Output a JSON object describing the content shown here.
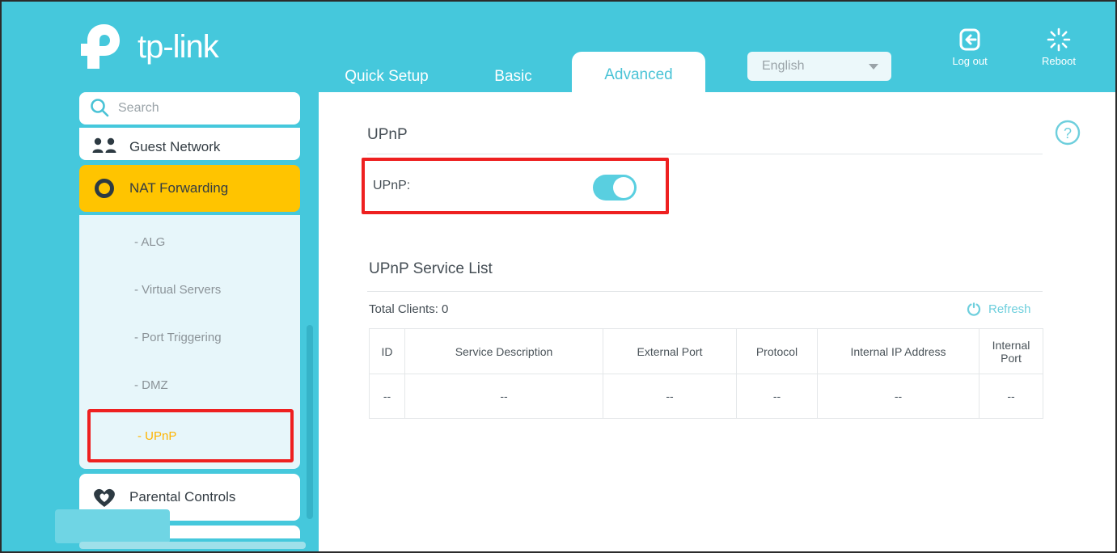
{
  "brand": {
    "name": "tp-link"
  },
  "header": {
    "tabs": [
      {
        "label": "Quick Setup",
        "active": false
      },
      {
        "label": "Basic",
        "active": false
      },
      {
        "label": "Advanced",
        "active": true
      }
    ],
    "language": {
      "selected": "English"
    },
    "actions": [
      {
        "label": "Log out",
        "icon": "logout-icon"
      },
      {
        "label": "Reboot",
        "icon": "reboot-icon"
      }
    ]
  },
  "sidebar": {
    "search": {
      "value": "",
      "placeholder": "Search"
    },
    "items": [
      {
        "label": "Guest Network",
        "icon": "guest-network-icon",
        "state": "partial-top"
      },
      {
        "label": "NAT Forwarding",
        "icon": "nat-forwarding-icon",
        "state": "active"
      },
      {
        "label": "Parental Controls",
        "icon": "parental-controls-icon",
        "state": "normal"
      }
    ],
    "submenu": [
      {
        "label": "- ALG",
        "selected": false
      },
      {
        "label": "- Virtual Servers",
        "selected": false
      },
      {
        "label": "- Port Triggering",
        "selected": false
      },
      {
        "label": "- DMZ",
        "selected": false
      },
      {
        "label": "- UPnP",
        "selected": true,
        "highlighted": true
      }
    ]
  },
  "content": {
    "upnp_section": {
      "title": "UPnP",
      "field_label": "UPnP:",
      "toggle_state": "on",
      "highlighted": true
    },
    "service_list": {
      "title": "UPnP Service List",
      "total_clients": "Total Clients: 0",
      "refresh_label": "Refresh",
      "columns": [
        "ID",
        "Service Description",
        "External Port",
        "Protocol",
        "Internal IP Address",
        "Internal Port"
      ],
      "rows": [
        [
          "--",
          "--",
          "--",
          "--",
          "--",
          "--"
        ]
      ]
    },
    "help_icon": "help-icon"
  },
  "colors": {
    "brand_teal": "#45c8dc",
    "accent_yellow": "#ffc400",
    "highlight_red": "#ee2020",
    "submenu_bg": "#e7f6fa",
    "selected_text": "#ffb400"
  }
}
